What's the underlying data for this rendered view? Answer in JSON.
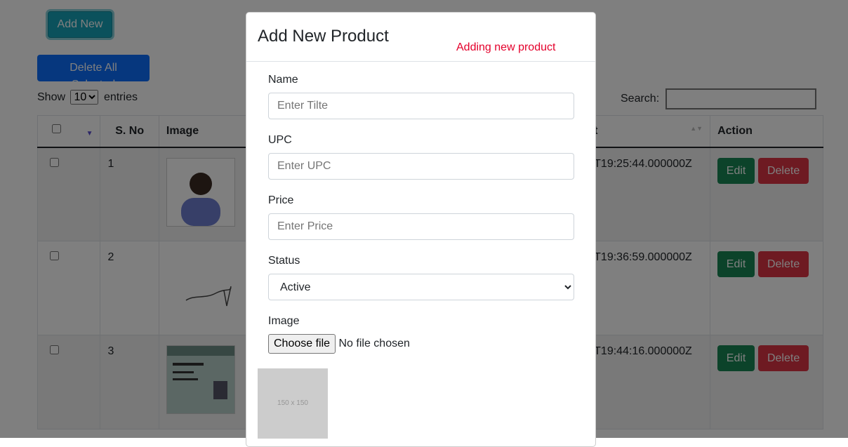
{
  "toolbar": {
    "add_new_label": "Add New",
    "delete_all_label": "Delete All Selected"
  },
  "length": {
    "show_label": "Show",
    "selected": "10",
    "entries_label": "entries"
  },
  "search": {
    "label": "Search:"
  },
  "table": {
    "headers": [
      "S. No",
      "Image",
      "",
      "t",
      "Action"
    ],
    "rows": [
      {
        "sno": "1",
        "created": "T19:25:44.000000Z",
        "edit": "Edit",
        "delete": "Delete"
      },
      {
        "sno": "2",
        "created": "T19:36:59.000000Z",
        "edit": "Edit",
        "delete": "Delete"
      },
      {
        "sno": "3",
        "created": "T19:44:16.000000Z",
        "edit": "Edit",
        "delete": "Delete"
      }
    ]
  },
  "modal": {
    "title": "Add New Product",
    "status": "Adding new product",
    "name_label": "Name",
    "name_placeholder": "Enter Tilte",
    "upc_label": "UPC",
    "upc_placeholder": "Enter UPC",
    "price_label": "Price",
    "price_placeholder": "Enter Price",
    "status_label": "Status",
    "status_value": "Active",
    "image_label": "Image",
    "choose_file": "Choose file",
    "no_file": "No file chosen",
    "preview_text": "150 x 150"
  },
  "colors": {
    "accent": "#17a2b8",
    "primary": "#0d6efd",
    "success": "#198754",
    "danger": "#dc3545",
    "status_text": "#e4002b"
  }
}
